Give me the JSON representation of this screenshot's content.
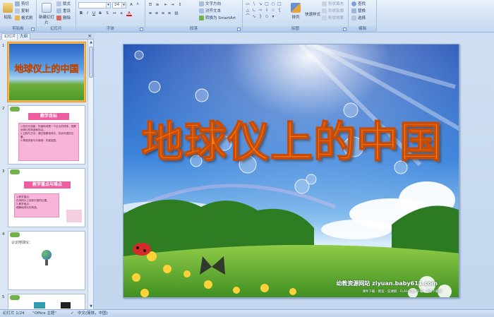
{
  "ribbon": {
    "clipboard": {
      "group": "剪贴板",
      "paste": "粘贴",
      "cut": "剪切",
      "copy": "复制",
      "format_painter": "格式刷"
    },
    "slides": {
      "group": "幻灯片",
      "new_slide": "新建幻灯片",
      "layout": "版式",
      "reset": "重设",
      "delete": "删除"
    },
    "font": {
      "group": "字体",
      "font_name": "",
      "font_size": "24"
    },
    "paragraph": {
      "group": "段落",
      "text_direction": "文字方向",
      "align_text": "对齐文本",
      "smartart": "转换为 SmartArt"
    },
    "drawing": {
      "group": "绘图",
      "arrange": "排列",
      "quick_styles": "快速样式",
      "shape_fill": "形状填充",
      "shape_outline": "形状轮廓",
      "shape_effects": "形状效果"
    },
    "editing": {
      "group": "编辑",
      "find": "查找",
      "replace": "替换",
      "select": "选择"
    }
  },
  "panel": {
    "tabs": [
      "幻灯片",
      "大纲"
    ],
    "slides": [
      {
        "num": "1",
        "title": "地球仪上的中国"
      },
      {
        "num": "2",
        "heading": "教学目标",
        "lines": [
          "1.知识与技能：知道地球是一个巨大的球体，观察地球仪的构造和特点。",
          "2.过程与方法：通过观察地球仪，找到中国的位置。",
          "3.情感态度与价值观：热爱祖国。"
        ]
      },
      {
        "num": "3",
        "heading": "教学重点与难点",
        "lines": [
          "1.教学重点：",
          "在地球仪上找到中国的位置。",
          "2.教学难点：",
          "理解地球仪的构造。"
        ]
      },
      {
        "num": "4",
        "heading": "认识地球仪："
      },
      {
        "num": "5"
      }
    ]
  },
  "slide": {
    "title": "地球仪上的中国",
    "site": "幼教资源网站 ziyuan.baby611.com",
    "site_sub": "课件下载 · 教案 · 说课稿 · FLASH课件下载 · 试卷下载网"
  },
  "status": {
    "slide": "幻灯片 1/24",
    "theme": "\"Office 主题\"",
    "language": "中文(简体，中国)"
  },
  "colors": {
    "title": "#f77a14",
    "title_stroke": "#c74c08",
    "sky_top": "#1e4fb5",
    "grass": "#5aa632",
    "thumb_heading_bg": "#ee5da0",
    "thumb_box_bg": "#f7b6d9"
  }
}
